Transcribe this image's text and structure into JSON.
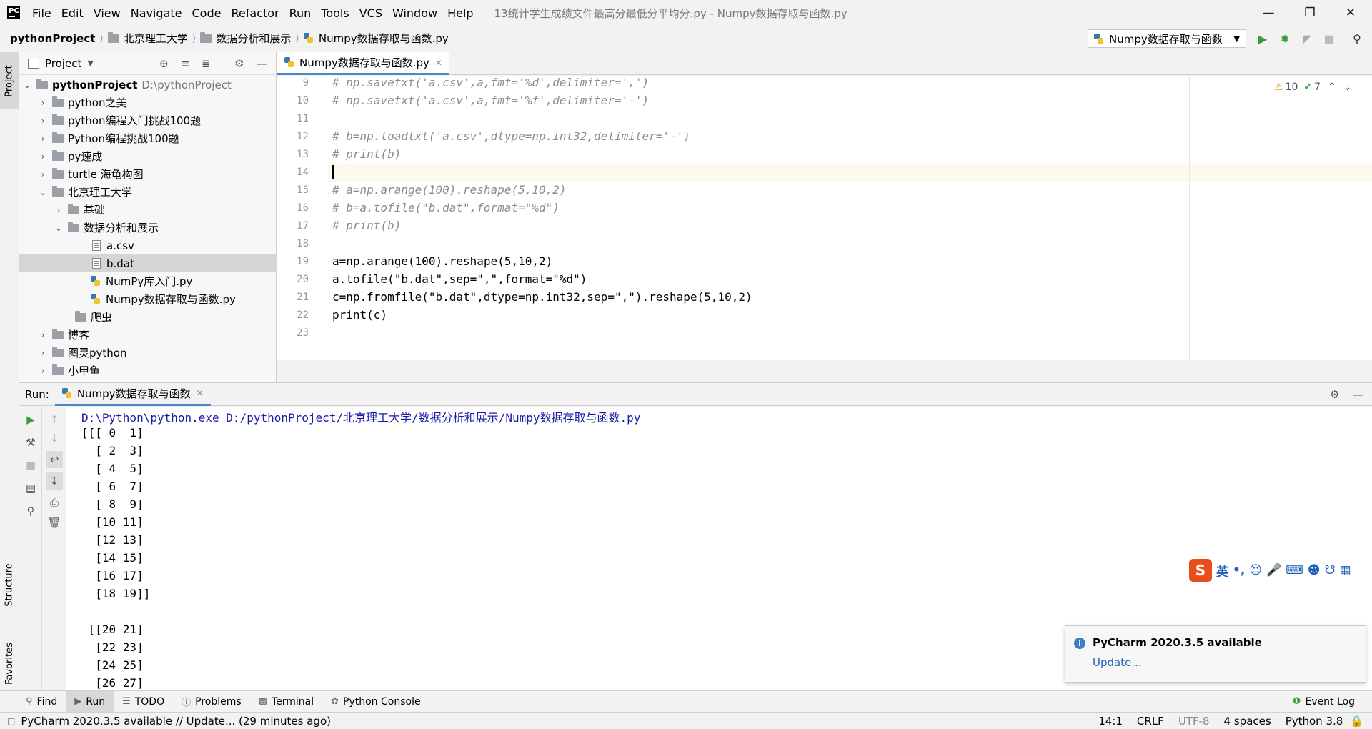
{
  "menubar": {
    "items": [
      "File",
      "Edit",
      "View",
      "Navigate",
      "Code",
      "Refactor",
      "Run",
      "Tools",
      "VCS",
      "Window",
      "Help"
    ],
    "window_title": "13统计学生成绩文件最高分最低分平均分.py - Numpy数据存取与函数.py"
  },
  "navbar": {
    "crumbs": [
      "pythonProject",
      "北京理工大学",
      "数据分析和展示",
      "Numpy数据存取与函数.py"
    ],
    "run_config": "Numpy数据存取与函数"
  },
  "project": {
    "title": "Project",
    "root_name": "pythonProject",
    "root_path": "D:\\pythonProject",
    "items": [
      {
        "label": "python之美"
      },
      {
        "label": "python编程入门挑战100题"
      },
      {
        "label": "Python编程挑战100题"
      },
      {
        "label": "py速成"
      },
      {
        "label": "turtle 海龟构图"
      },
      {
        "label": "北京理工大学"
      },
      {
        "label": "基础"
      },
      {
        "label": "数据分析和展示"
      },
      {
        "label": "a.csv"
      },
      {
        "label": "b.dat"
      },
      {
        "label": "NumPy库入门.py"
      },
      {
        "label": "Numpy数据存取与函数.py"
      },
      {
        "label": "爬虫"
      },
      {
        "label": "博客"
      },
      {
        "label": "图灵python"
      },
      {
        "label": "小甲鱼"
      }
    ]
  },
  "left_strip": {
    "project": "Project",
    "structure": "Structure",
    "favorites": "Favorites"
  },
  "editor": {
    "tab": "Numpy数据存取与函数.py",
    "warnings": "10",
    "weak_warnings": "7",
    "line_numbers": [
      "9",
      "10",
      "11",
      "12",
      "13",
      "14",
      "15",
      "16",
      "17",
      "18",
      "19",
      "20",
      "21",
      "22",
      "23"
    ],
    "lines": [
      "# np.savetxt('a.csv',a,fmt='%d',delimiter=',')",
      "# np.savetxt('a.csv',a,fmt='%f',delimiter='-')",
      "",
      "# b=np.loadtxt('a.csv',dtype=np.int32,delimiter='-')",
      "# print(b)",
      "",
      "# a=np.arange(100).reshape(5,10,2)",
      "# b=a.tofile(\"b.dat\",format=\"%d\")",
      "# print(b)",
      "",
      "a=np.arange(100).reshape(5,10,2)",
      "a.tofile(\"b.dat\",sep=\",\",format=\"%d\")",
      "c=np.fromfile(\"b.dat\",dtype=np.int32,sep=\",\").reshape(5,10,2)",
      "print(c)",
      ""
    ]
  },
  "run": {
    "label": "Run:",
    "tab": "Numpy数据存取与函数",
    "command": "D:\\Python\\python.exe D:/pythonProject/北京理工大学/数据分析和展示/Numpy数据存取与函数.py",
    "output": [
      "[[[ 0  1]",
      "  [ 2  3]",
      "  [ 4  5]",
      "  [ 6  7]",
      "  [ 8  9]",
      "  [10 11]",
      "  [12 13]",
      "  [14 15]",
      "  [16 17]",
      "  [18 19]]",
      "",
      " [[20 21]",
      "  [22 23]",
      "  [24 25]",
      "  [26 27]"
    ]
  },
  "notification": {
    "title": "PyCharm 2020.3.5 available",
    "link": "Update..."
  },
  "ime": {
    "mode": "英"
  },
  "bottom_tools": [
    "Find",
    "Run",
    "TODO",
    "Problems",
    "Terminal",
    "Python Console",
    "Event Log"
  ],
  "status": {
    "message": "PyCharm 2020.3.5 available // Update... (29 minutes ago)",
    "position": "14:1",
    "line_sep": "CRLF",
    "encoding": "UTF-8",
    "indent": "4 spaces",
    "interpreter": "Python 3.8"
  },
  "colors": {
    "accent": "#4a88c7",
    "run_green": "#3c9c3c",
    "link_blue": "#1f5fb8",
    "selection": "#d5d5d5"
  }
}
